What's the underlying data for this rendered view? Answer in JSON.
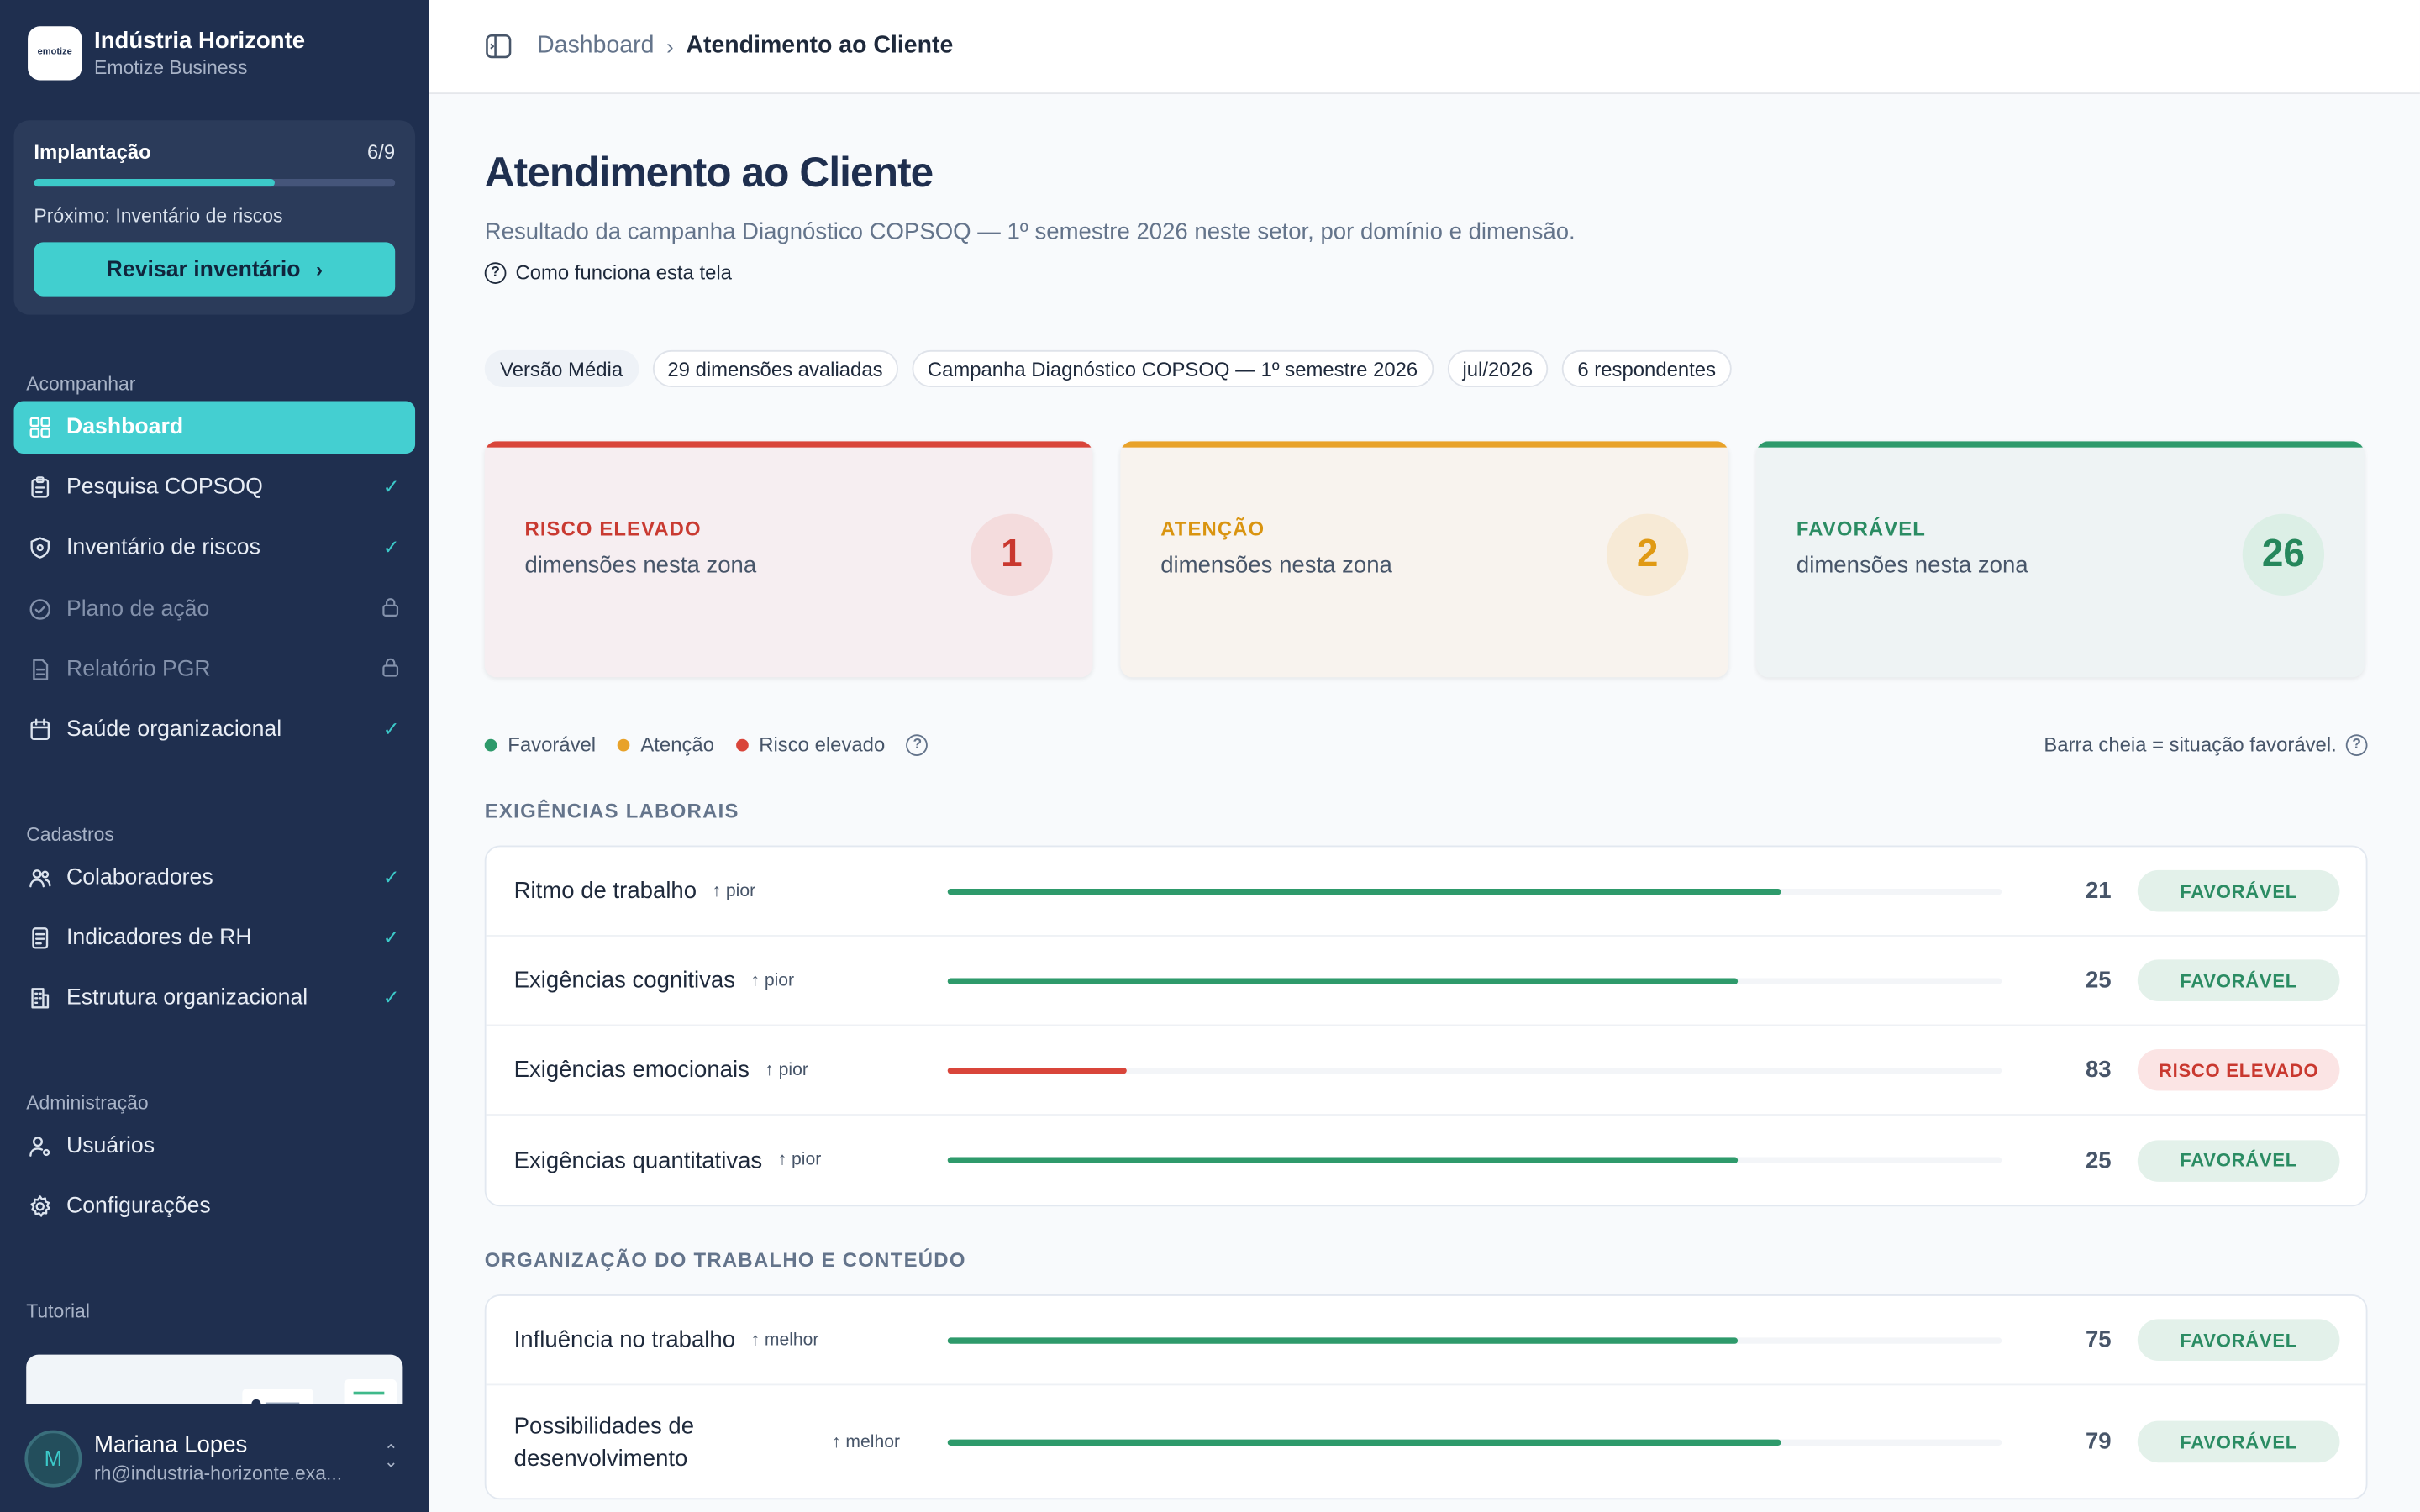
{
  "org": {
    "logo_text": "emotize",
    "name": "Indústria Horizonte",
    "subtitle": "Emotize Business"
  },
  "implantacao": {
    "label": "Implantação",
    "count": "6/9",
    "progress": 0.667,
    "next": "Próximo: Inventário de riscos",
    "button": "Revisar inventário"
  },
  "nav": {
    "acompanhar": {
      "title": "Acompanhar",
      "items": [
        {
          "label": "Dashboard",
          "icon": "grid-icon",
          "state": "active"
        },
        {
          "label": "Pesquisa COPSOQ",
          "icon": "clipboard-icon",
          "state": "done"
        },
        {
          "label": "Inventário de riscos",
          "icon": "shield-icon",
          "state": "done"
        },
        {
          "label": "Plano de ação",
          "icon": "check-circle-icon",
          "state": "locked"
        },
        {
          "label": "Relatório PGR",
          "icon": "file-icon",
          "state": "locked"
        },
        {
          "label": "Saúde organizacional",
          "icon": "calendar-icon",
          "state": "done"
        }
      ]
    },
    "cadastros": {
      "title": "Cadastros",
      "items": [
        {
          "label": "Colaboradores",
          "icon": "users-icon",
          "state": "done"
        },
        {
          "label": "Indicadores de RH",
          "icon": "document-icon",
          "state": "done"
        },
        {
          "label": "Estrutura organizacional",
          "icon": "building-icon",
          "state": "done"
        }
      ]
    },
    "administracao": {
      "title": "Administração",
      "items": [
        {
          "label": "Usuários",
          "icon": "user-cog-icon",
          "state": ""
        },
        {
          "label": "Configurações",
          "icon": "gear-icon",
          "state": ""
        }
      ]
    },
    "tutorial": {
      "title": "Tutorial"
    }
  },
  "user": {
    "initial": "M",
    "name": "Mariana Lopes",
    "email": "rh@industria-horizonte.exa..."
  },
  "breadcrumb": {
    "parent": "Dashboard",
    "sep": "›",
    "current": "Atendimento ao Cliente"
  },
  "page": {
    "title": "Atendimento ao Cliente",
    "subtitle": "Resultado da campanha Diagnóstico COPSOQ — 1º semestre 2026 neste setor, por domínio e dimensão.",
    "howto": "Como funciona esta tela"
  },
  "chips": [
    "Versão Média",
    "29 dimensões avaliadas",
    "Campanha Diagnóstico COPSOQ — 1º semestre 2026",
    "jul/2026",
    "6 respondentes"
  ],
  "cards": [
    {
      "label": "RISCO ELEVADO",
      "desc": "dimensões nesta zona",
      "value": "1"
    },
    {
      "label": "ATENÇÃO",
      "desc": "dimensões nesta zona",
      "value": "2"
    },
    {
      "label": "FAVORÁVEL",
      "desc": "dimensões nesta zona",
      "value": "26"
    }
  ],
  "legend": {
    "items": [
      {
        "label": "Favorável",
        "color": "#2e9a6b"
      },
      {
        "label": "Atenção",
        "color": "#e8a22a"
      },
      {
        "label": "Risco elevado",
        "color": "#d9453a"
      }
    ],
    "note": "Barra cheia = situação favorável."
  },
  "colors": {
    "favoravel": "#2e9a6b",
    "atencao": "#e8a22a",
    "risco": "#d9453a",
    "accent": "#44cfd1"
  },
  "sections": [
    {
      "title": "EXIGÊNCIAS LABORAIS",
      "rows": [
        {
          "name": "Ritmo de trabalho",
          "trend": "↑ pior",
          "score": "21",
          "fill": 0.79,
          "status": "FAVORÁVEL",
          "level": "fav"
        },
        {
          "name": "Exigências cognitivas",
          "trend": "↑ pior",
          "score": "25",
          "fill": 0.75,
          "status": "FAVORÁVEL",
          "level": "fav"
        },
        {
          "name": "Exigências emocionais",
          "trend": "↑ pior",
          "score": "83",
          "fill": 0.17,
          "status": "RISCO ELEVADO",
          "level": "risk"
        },
        {
          "name": "Exigências quantitativas",
          "trend": "↑ pior",
          "score": "25",
          "fill": 0.75,
          "status": "FAVORÁVEL",
          "level": "fav"
        }
      ]
    },
    {
      "title": "ORGANIZAÇÃO DO TRABALHO E CONTEÚDO",
      "rows": [
        {
          "name": "Influência no trabalho",
          "trend": "↑ melhor",
          "score": "75",
          "fill": 0.75,
          "status": "FAVORÁVEL",
          "level": "fav"
        },
        {
          "name": "Possibilidades de desenvolvimento",
          "trend": "↑ melhor",
          "score": "79",
          "fill": 0.79,
          "status": "FAVORÁVEL",
          "level": "fav"
        }
      ]
    }
  ]
}
